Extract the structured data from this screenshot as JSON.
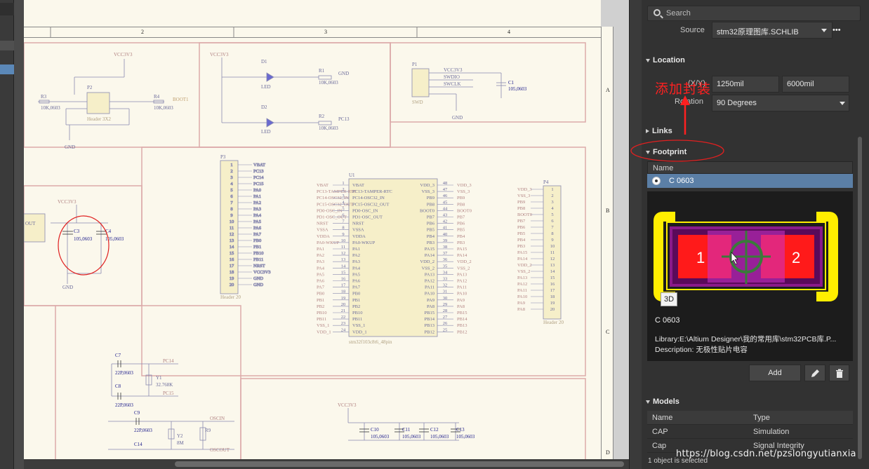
{
  "panel": {
    "search_placeholder": "Search",
    "source_label": "Source",
    "source_value": "stm32原理图库.SCHLIB",
    "source_more": "•••",
    "location_title": "Location",
    "xy_label": "(X/Y)",
    "x_value": "1250mil",
    "y_value": "6000mil",
    "rotation_label": "Rotation",
    "rotation_value": "90 Degrees",
    "links_title": "Links",
    "footprint_title": "Footprint",
    "footprint_table": {
      "header": "Name",
      "selected_row": "C 0603"
    },
    "preview": {
      "button_3d": "3D",
      "pad1": "1",
      "pad2": "2",
      "name": "C 0603",
      "library": "Library:E:\\Altium Designer\\我的常用库\\stm32PCB库.P...",
      "description": "Description: 无极性贴片电容"
    },
    "add_button": "Add",
    "models_title": "Models",
    "models_table": {
      "headers": [
        "Name",
        "Type"
      ],
      "rows": [
        {
          "name": "CAP",
          "type": "Simulation"
        },
        {
          "name": "Cap",
          "type": "Signal Integrity"
        }
      ]
    },
    "status": "1 object is selected"
  },
  "annotation": {
    "text": "添加封装",
    "color": "#ff2020"
  },
  "watermark": "https://blog.csdn.net/pzslongyutianxia",
  "schematic": {
    "zone_columns": [
      "2",
      "3",
      "4"
    ],
    "zone_rows": [
      "A",
      "B",
      "C",
      "D"
    ],
    "labels": {
      "vcc": "VCC3V3",
      "gnd": "GND",
      "d1": "D1",
      "d2": "D2",
      "led": "LED",
      "r1": "R1",
      "r2": "R2",
      "r3": "R3",
      "r4": "R4",
      "r9": "R9",
      "res_val": "10K,0603",
      "p1": "P1",
      "p2": "P2",
      "p3": "P3",
      "p4": "P4",
      "u1": "U1",
      "c1": "C1",
      "c3": "C3",
      "c4": "C4",
      "c7": "C7",
      "c8": "C8",
      "c9": "C9",
      "c10": "C10",
      "c11": "C11",
      "c12": "C12",
      "c13": "C13",
      "c14": "C14",
      "cap_val": "105,0603",
      "cap22": "22P,0603",
      "osc": "OSCIN",
      "oscout": "OSCOUT",
      "boot": "BOOT1",
      "swd": "SWD",
      "header": "Header 20",
      "header32": "Header 3X2",
      "u1_name": "stm32f103c8t6_48pin",
      "y1": "Y1",
      "y2": "Y2",
      "xtal1": "32.768K",
      "xtal2": "8M",
      "pc14": "PC14",
      "pc15": "PC15",
      "pc13": "PC13",
      "swdio": "SWDIO",
      "swclk": "SWCLK",
      "out": "OUT"
    },
    "u1_left": [
      "VBAT",
      "PC13-TAMPER-RTC",
      "PC14-OSC32_IN",
      "PC15-OSC32_OUT",
      "PD0-OSC_IN",
      "PD1-OSC_OUT",
      "NRST",
      "VSSA",
      "VDDA",
      "PA0-WKUP",
      "PA1",
      "PA2",
      "PA3",
      "PA4",
      "PA5",
      "PA6",
      "PA7",
      "PB0",
      "PB1",
      "PB2",
      "PB10",
      "PB11",
      "VSS_1",
      "VDD_1"
    ],
    "u1_right": [
      "VDD_3",
      "VSS_3",
      "PB9",
      "PB8",
      "BOOT0",
      "PB7",
      "PB6",
      "PB5",
      "PB4",
      "PB3",
      "PA15",
      "PA14",
      "VDD_2",
      "VSS_2",
      "PA13",
      "PA12",
      "PA11",
      "PA10",
      "PA9",
      "PA8",
      "PB15",
      "PB14",
      "PB13",
      "PB12"
    ],
    "p3_pins": [
      "VBAT",
      "PC13",
      "PC14",
      "PC15",
      "PA0",
      "PA1",
      "PA2",
      "PA3",
      "PA4",
      "PA5",
      "PA6",
      "PA7",
      "PB0",
      "PB1",
      "PB10",
      "PB11",
      "NRST",
      "VCC3V3",
      "GND",
      "GND"
    ]
  }
}
